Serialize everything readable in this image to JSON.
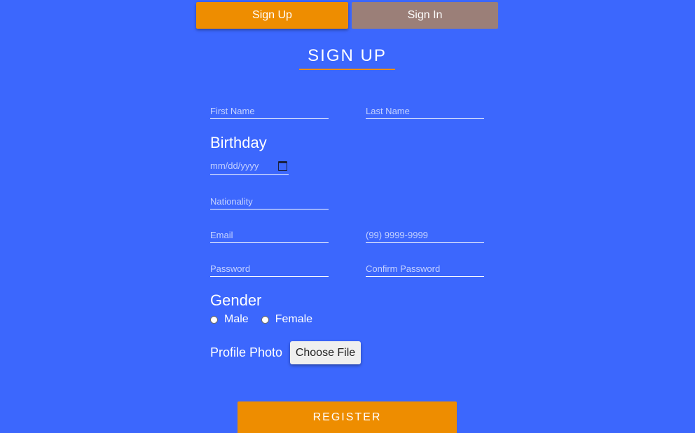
{
  "tabs": {
    "signup_label": "Sign Up",
    "signin_label": "Sign In"
  },
  "title": "SIGN UP",
  "form": {
    "first_name_placeholder": "First Name",
    "last_name_placeholder": "Last Name",
    "birthday_label": "Birthday",
    "birthday_placeholder": "mm/dd/yyyy",
    "nationality_placeholder": "Nationality",
    "email_placeholder": "Email",
    "phone_placeholder": "(99) 9999-9999",
    "password_placeholder": "Password",
    "confirm_password_placeholder": "Confirm Password",
    "gender_label": "Gender",
    "gender_options": [
      "Male",
      "Female"
    ],
    "profile_photo_label": "Profile Photo",
    "choose_file_label": "Choose File",
    "register_label": "REGISTER"
  },
  "colors": {
    "background": "#3c67fd",
    "accent": "#ee8d00",
    "inactive_tab": "#9b7f78"
  },
  "icons": {
    "date_picker": "calendar-icon"
  }
}
